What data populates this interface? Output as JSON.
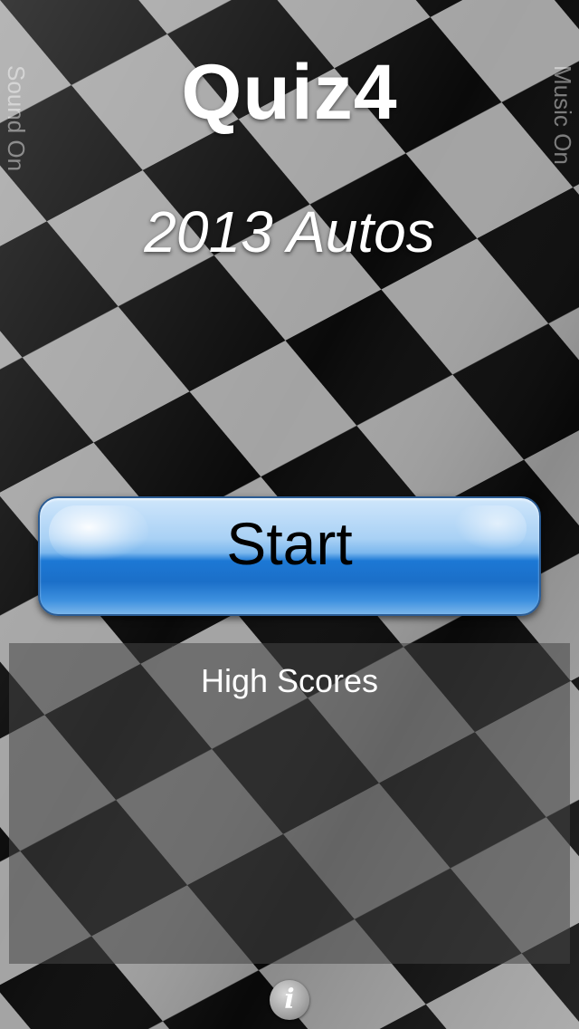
{
  "app": {
    "title": "Quiz4",
    "subtitle": "2013 Autos"
  },
  "toggles": {
    "sound_label": "Sound On",
    "music_label": "Music On"
  },
  "start_button": {
    "label": "Start",
    "color": "#1c78d5"
  },
  "high_scores": {
    "title": "High Scores"
  },
  "info_button": {
    "glyph": "i",
    "icon": "info-icon"
  },
  "background": {
    "description": "checkered-flag",
    "dark": "#000000",
    "light": "#9a9a9a"
  }
}
